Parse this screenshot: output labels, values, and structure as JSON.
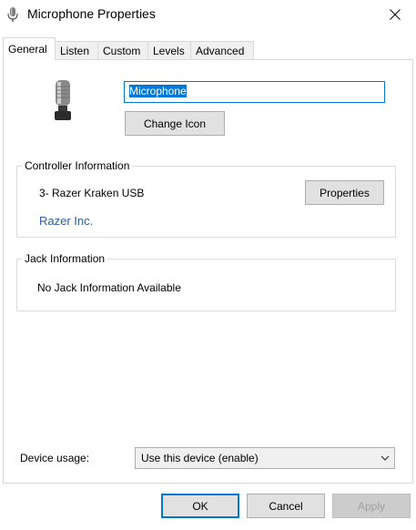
{
  "window": {
    "title": "Microphone Properties",
    "title_icon": "microphone-icon",
    "close_icon": "close-icon"
  },
  "tabs": [
    {
      "label": "General",
      "active": true
    },
    {
      "label": "Listen",
      "active": false
    },
    {
      "label": "Custom",
      "active": false
    },
    {
      "label": "Levels",
      "active": false
    },
    {
      "label": "Advanced",
      "active": false
    }
  ],
  "general": {
    "device_icon": "microphone-icon",
    "name_value": "Microphone",
    "change_icon_label": "Change Icon",
    "controller": {
      "group_label": "Controller Information",
      "device_name": "3- Razer Kraken USB",
      "properties_label": "Properties",
      "vendor_link": "Razer Inc."
    },
    "jack": {
      "group_label": "Jack Information",
      "status": "No Jack Information Available"
    },
    "device_usage": {
      "label": "Device usage:",
      "selected": "Use this device (enable)"
    }
  },
  "footer": {
    "ok_label": "OK",
    "cancel_label": "Cancel",
    "apply_label": "Apply"
  },
  "colors": {
    "accent": "#0078d7",
    "link": "#2e5d9f",
    "button_face": "#e1e1e1"
  }
}
